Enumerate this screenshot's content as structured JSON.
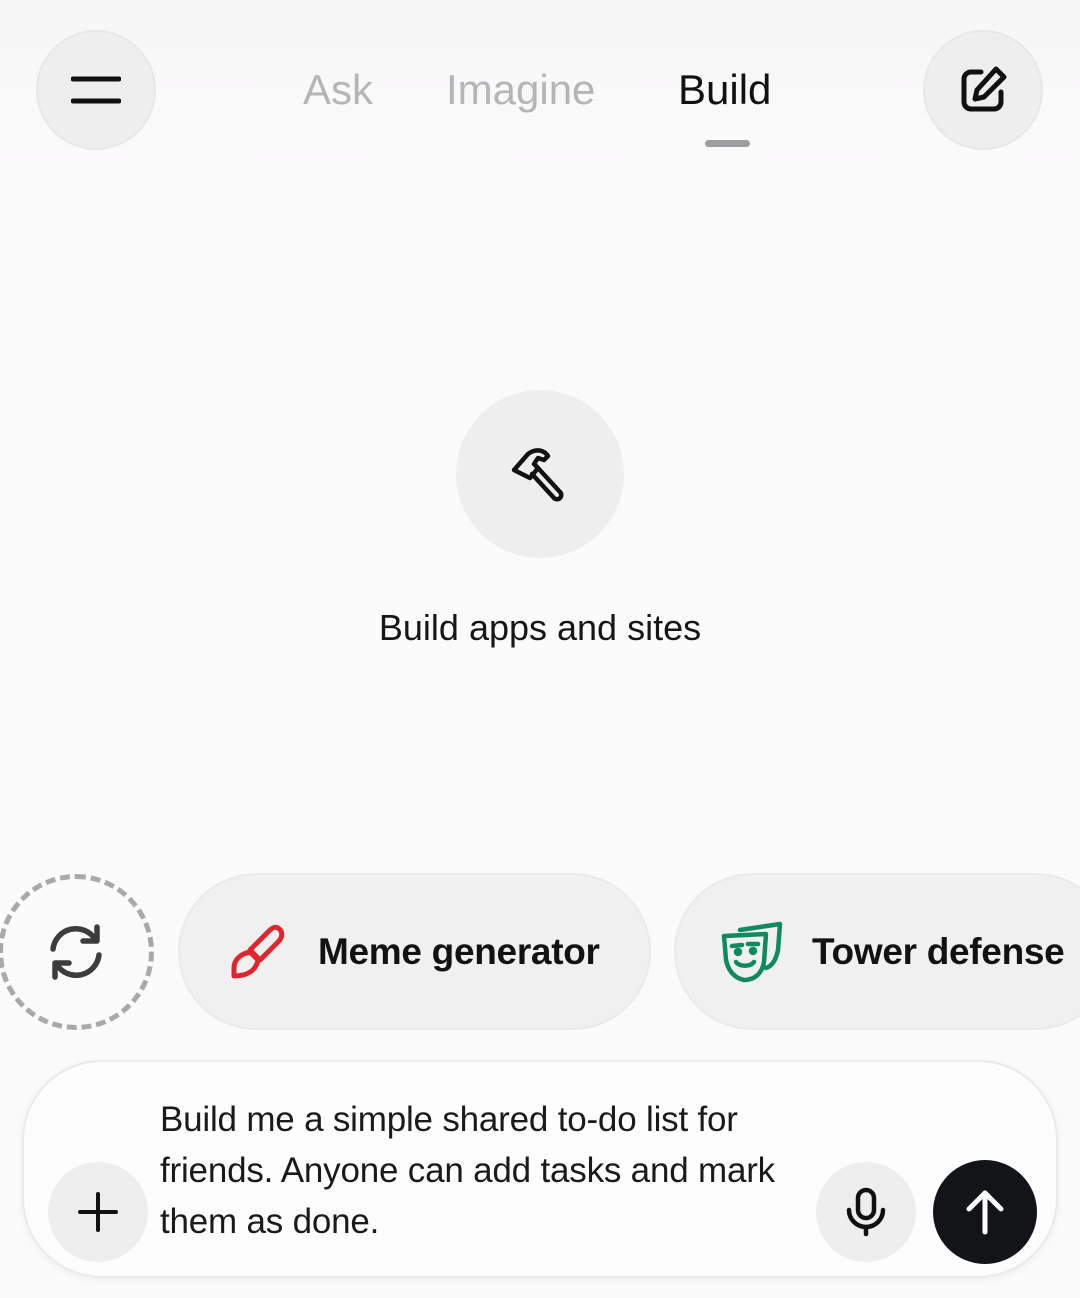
{
  "header": {
    "menu_icon": "menu-icon",
    "compose_icon": "compose-icon",
    "tabs": [
      {
        "label": "Ask",
        "active": false
      },
      {
        "label": "Imagine",
        "active": false
      },
      {
        "label": "Build",
        "active": true
      }
    ]
  },
  "hero": {
    "icon": "hammer-icon",
    "caption": "Build apps and sites"
  },
  "suggestions": {
    "refresh_icon": "refresh-icon",
    "chips": [
      {
        "label": "Meme generator",
        "icon": "paintbrush-icon",
        "icon_color": "#e0262d"
      },
      {
        "label": "Tower defense",
        "icon": "theater-masks-icon",
        "icon_color": "#0f8a5f"
      }
    ]
  },
  "composer": {
    "text": "Build me a simple shared to-do list for friends. Anyone can add tasks and mark them as done.",
    "add_icon": "plus-icon",
    "mic_icon": "microphone-icon",
    "send_icon": "arrow-up-icon"
  },
  "colors": {
    "background": "#fcfbfc",
    "inactive_tab": "#b5b4b6",
    "active_tab": "#111111",
    "send_button": "#121417"
  }
}
